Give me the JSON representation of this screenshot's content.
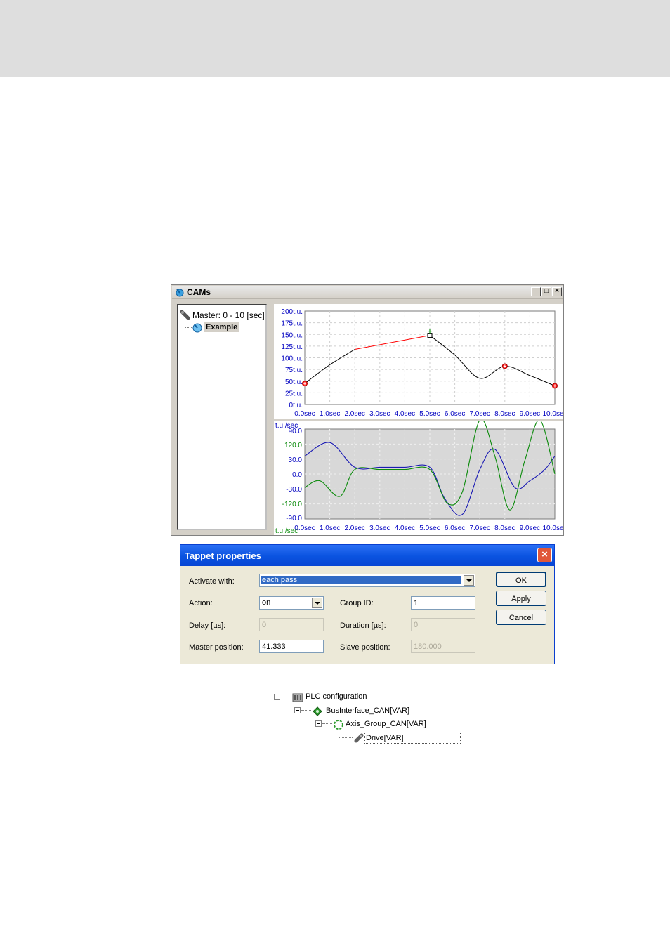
{
  "cams_window": {
    "title": "CAMs",
    "tree": {
      "master": "Master: 0 - 10 [sec]",
      "cam": "Example"
    },
    "position_chart": {
      "y_ticks": [
        "200t.u.",
        "175t.u.",
        "150t.u.",
        "125t.u.",
        "100t.u.",
        "75t.u.",
        "50t.u.",
        "25t.u.",
        "0t.u."
      ],
      "x_ticks": [
        "0.0sec",
        "1.0sec",
        "2.0sec",
        "3.0sec",
        "4.0sec",
        "5.0sec",
        "6.0sec",
        "7.0sec",
        "8.0sec",
        "9.0sec",
        "10.0sec"
      ]
    },
    "velocity_chart": {
      "unit_top": "t.u./sec",
      "unit_bottom": "t.u./sec",
      "y_ticks_blue": [
        "90.0",
        "30.0",
        "0.0",
        "-30.0",
        "-90.0"
      ],
      "y_ticks_green": [
        "120.0",
        "0.0",
        "-120.0"
      ],
      "x_ticks": [
        "0.0sec",
        "1.0sec",
        "2.0sec",
        "3.0sec",
        "4.0sec",
        "5.0sec",
        "6.0sec",
        "7.0sec",
        "8.0sec",
        "9.0sec",
        "10.0sec"
      ]
    },
    "colors": {
      "position": "#000000",
      "selected_segment": "#ff0000",
      "velocity": "#1a1ab4",
      "acceleration": "#0a8a0a",
      "axis_text": "#0000c0"
    }
  },
  "chart_data": [
    {
      "type": "line",
      "x": [
        0,
        1,
        2,
        3,
        4,
        5,
        6,
        7,
        8,
        9,
        10
      ],
      "series": [
        {
          "values": [
            45,
            85,
            118,
            128,
            138,
            148,
            106,
            56,
            82,
            62,
            40
          ]
        }
      ],
      "ylim": [
        0,
        200
      ],
      "xlim": [
        0,
        10
      ],
      "grid": true
    },
    {
      "type": "line",
      "x": [
        0,
        1,
        2,
        3,
        4,
        5,
        6,
        7,
        8,
        9,
        10
      ],
      "series": [
        {
          "values": [
            40,
            70,
            15,
            15,
            15,
            15,
            -90,
            10,
            -30,
            -10,
            40
          ]
        },
        {
          "values": [
            -30,
            -50,
            10,
            10,
            10,
            10,
            -80,
            120,
            -80,
            120,
            0
          ]
        }
      ],
      "grid": true
    }
  ],
  "dialog": {
    "title": "Tappet properties",
    "activate_label": "Activate with:",
    "activate_value": "each pass",
    "action_label": "Action:",
    "action_value": "on",
    "group_id_label": "Group ID:",
    "group_id_value": "1",
    "delay_label": "Delay [µs]:",
    "delay_value": "0",
    "duration_label": "Duration [µs]:",
    "duration_value": "0",
    "master_pos_label": "Master position:",
    "master_pos_value": "41.333",
    "slave_pos_label": "Slave position:",
    "slave_pos_value": "180.000",
    "ok_label": "OK",
    "apply_label": "Apply",
    "cancel_label": "Cancel"
  },
  "plc_tree": {
    "root": "PLC configuration",
    "bus": "BusInterface_CAN[VAR]",
    "group": "Axis_Group_CAN[VAR]",
    "drive": "Drive[VAR]"
  }
}
